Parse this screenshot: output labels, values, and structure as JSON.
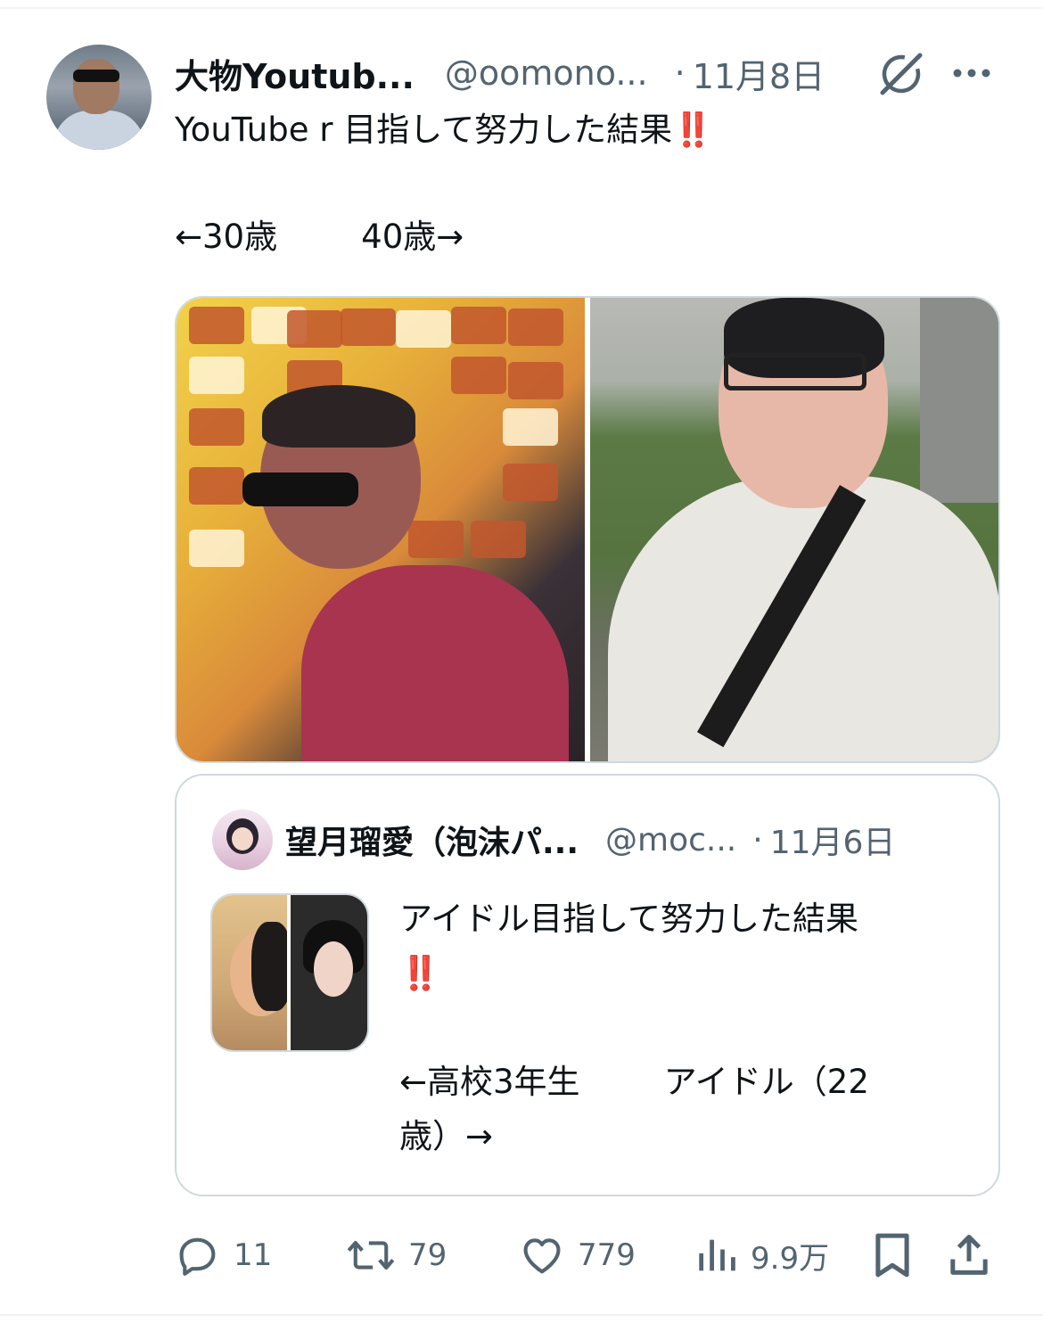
{
  "tweet": {
    "author_name": "大物Youtub...",
    "author_handle": "@oomono...",
    "separator": "·",
    "date": "11月8日",
    "text_line1": "YouTube r 目指して努力した結果",
    "emoji_bang": "‼️",
    "text_line3": "←30歳        40歳→"
  },
  "quoted": {
    "author_name": "望月瑠愛（泡沫パ...",
    "author_handle": "@moc...",
    "separator": "·",
    "date": "11月6日",
    "text": "アイドル目指して努力した結果\n‼️\n\n←高校3年生        アイドル（22\n歳）→"
  },
  "actions": {
    "replies": "11",
    "reposts": "79",
    "likes": "779",
    "views": "9.9万"
  },
  "icons": [
    "grok-icon",
    "more-icon",
    "reply-icon",
    "repost-icon",
    "like-icon",
    "views-icon",
    "bookmark-icon",
    "share-icon"
  ],
  "colors": {
    "text": "#0f1419",
    "secondary": "#536471",
    "border": "#cfd9de",
    "bang": "#d42535"
  }
}
